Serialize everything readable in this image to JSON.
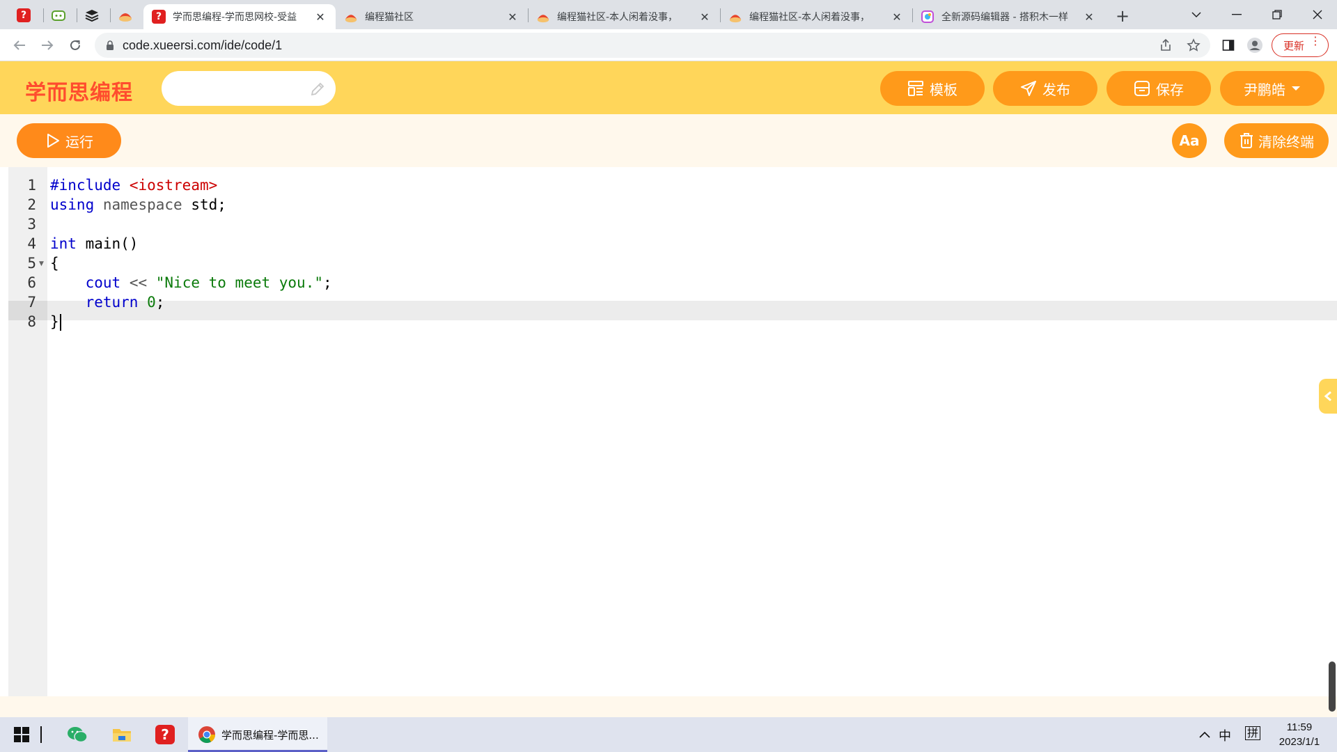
{
  "browser": {
    "tabs": [
      {
        "title": "学而思编程-学而思网校-受益",
        "active": true
      },
      {
        "title": "编程猫社区",
        "active": false
      },
      {
        "title": "编程猫社区-本人闲着没事，",
        "active": false
      },
      {
        "title": "编程猫社区-本人闲着没事，",
        "active": false
      },
      {
        "title": "全新源码编辑器 - 搭积木一样",
        "active": false
      }
    ],
    "url": "code.xueersi.com/ide/code/1",
    "update_label": "更新"
  },
  "app": {
    "logo": "学而思编程",
    "title_input_value": "",
    "buttons": {
      "template": "模板",
      "publish": "发布",
      "save": "保存",
      "user": "尹鹏皓"
    },
    "run_label": "运行",
    "font_label": "Aa",
    "clear_label": "清除终端"
  },
  "editor": {
    "language": "C++",
    "line_numbers": [
      "1",
      "2",
      "3",
      "4",
      "5",
      "6",
      "7",
      "8"
    ],
    "lines": [
      "#include <iostream>",
      "using namespace std;",
      "",
      "int main()",
      "{",
      "    cout << \"Nice to meet you.\";",
      "    return 0;",
      "}"
    ],
    "active_line": 8
  },
  "taskbar": {
    "app_label": "学而思编程-学而思...",
    "ime_lang": "中",
    "ime_mode": "拼",
    "time": "11:59",
    "date": "2023/1/1"
  },
  "colors": {
    "header_bg": "#ffd65a",
    "button_orange": "#ff9a1a",
    "logo_red": "#ff4d2e"
  }
}
